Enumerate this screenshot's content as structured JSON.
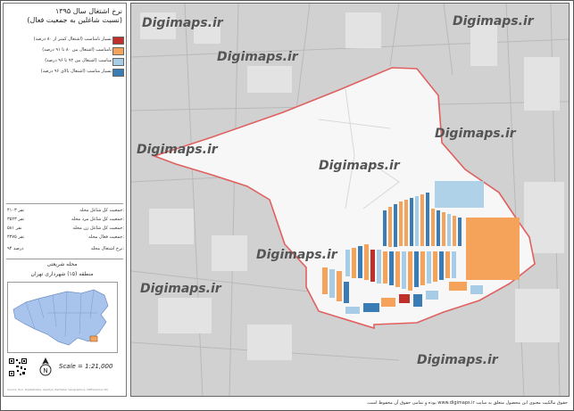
{
  "legend": {
    "title_line1": "نرخ اشتغال سال ۱۳۹۵",
    "title_line2": "(نسبت شاغلین به جمعیت فعال)",
    "items": [
      {
        "label": "بسیار نامناسب (اشتغال کمتر از ۸۰ درصد)",
        "color": "#c0302a"
      },
      {
        "label": "نامناسب (اشتغال بین ۸۰ تا ۹۱ درصد)",
        "color": "#f5a25a"
      },
      {
        "label": "مناسب (اشتغال بین ۹۲ تا ۹۶ درصد)",
        "color": "#a7cde6"
      },
      {
        "label": "بسیار مناسب (اشتغال بالای ۹۶ درصد)",
        "color": "#3a7db6"
      }
    ],
    "stats": [
      {
        "label": "جمعیت کل شاغل محله:",
        "value": "۴۱۰۳ نفر"
      },
      {
        "label": "جمعیت کل شاغل مرد محله:",
        "value": "۳۵۲۳ نفر"
      },
      {
        "label": "جمعیت کل شاغل زن محله:",
        "value": "۵۸۱ نفر"
      },
      {
        "label": "جمعیت فعال محله:",
        "value": "۴۳۷۵ نفر"
      },
      {
        "label": "نرخ اشتغال محله:",
        "value": "۹۴ درصد"
      }
    ],
    "position_title": "محله شریعتی",
    "position_subtitle": "منطقه (۱۵) شهرداری تهران",
    "scale": "Scale = 1:21,000",
    "credits": "Source: Esri, DigitalGlobe, GeoEye, Earthstar Geographics, CNES/Airbus DS"
  },
  "watermark": "Digimaps.ir",
  "footer": "حقوق مالکیت معنوی این محصول متعلق به سایت www.digimaps.ir بوده و تمامی حقوق آن محفوظ است.",
  "colors": {
    "very_poor": "#c0302a",
    "poor": "#f5a25a",
    "good": "#a7cde6",
    "very_good": "#3a7db6",
    "boundary": "#e06060"
  }
}
